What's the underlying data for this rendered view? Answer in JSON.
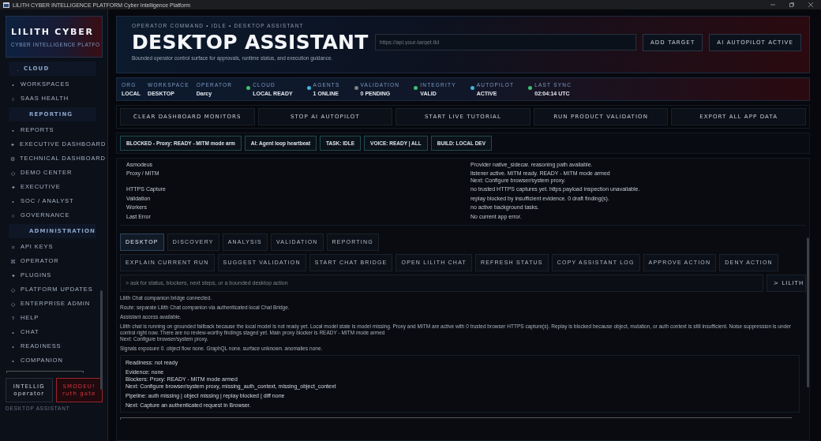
{
  "window": {
    "title": "LILITH CYBER INTELLIGENCE PLATFORM Cyber Intelligence Platform"
  },
  "brand": {
    "name": "LILITH CYBER",
    "tagline": "CYBER INTELLIGENCE PLATFO"
  },
  "sidebar": {
    "sections": [
      {
        "title": "CLOUD",
        "mark": ".",
        "items": [
          {
            "glyph": "•",
            "label": "WORKSPACES"
          },
          {
            "glyph": "○",
            "label": "SAAS HEALTH"
          }
        ]
      },
      {
        "title": "REPORTING",
        "items": [
          {
            "glyph": "▪",
            "label": "REPORTS"
          },
          {
            "glyph": "✦",
            "label": "EXECUTIVE DASHBOARD"
          },
          {
            "glyph": "⚙",
            "label": "TECHNICAL DASHBOARD"
          },
          {
            "glyph": "◇",
            "label": "DEMO CENTER"
          },
          {
            "glyph": "✦",
            "label": "EXECUTIVE"
          },
          {
            "glyph": "•",
            "label": "SOC / ANALYST"
          },
          {
            "glyph": "○",
            "label": "GOVERNANCE"
          }
        ]
      },
      {
        "title": "ADMINISTRATION",
        "items": [
          {
            "glyph": "≡",
            "label": "API KEYS"
          },
          {
            "glyph": "⌘",
            "label": "OPERATOR"
          },
          {
            "glyph": "✦",
            "label": "PLUGINS"
          },
          {
            "glyph": "◇",
            "label": "PLATFORM UPDATES"
          },
          {
            "glyph": "◇",
            "label": "ENTERPRISE ADMIN"
          },
          {
            "glyph": "?",
            "label": "HELP"
          },
          {
            "glyph": "•",
            "label": "CHAT"
          },
          {
            "glyph": "•",
            "label": "READINESS"
          },
          {
            "glyph": "•",
            "label": "COMPANION"
          }
        ]
      }
    ],
    "cards": [
      {
        "kind": "plain",
        "line1": "INTELLIG",
        "line2": "operator"
      },
      {
        "kind": "alert",
        "line1": "SMODEU!",
        "line2": "ruth gate"
      }
    ],
    "footer": "DESKTOP ASSISTANT"
  },
  "header": {
    "breadcrumb": "OPERATOR COMMAND • IDLE • DESKTOP ASSISTANT",
    "title": "DESKTOP ASSISTANT",
    "subtitle": "Bounded operator control surface for approvals, runtime status, and execution guidance.",
    "target": {
      "placeholder": "https://api.your-target.tld"
    },
    "buttons": [
      "ADD TARGET",
      "AI AUTOPILOT ACTIVE"
    ]
  },
  "context": [
    {
      "label": "ORG",
      "value": "LOCAL"
    },
    {
      "label": "WORKSPACE",
      "value": "DESKTOP"
    },
    {
      "label": "OPERATOR",
      "value": "Darcy"
    }
  ],
  "statuses": [
    {
      "label": "CLOUD",
      "value": "LOCAL READY",
      "color": "#3fbf6f"
    },
    {
      "label": "AGENTS",
      "value": "1 ONLINE",
      "color": "#3fb6d8"
    },
    {
      "label": "VALIDATION",
      "value": "0 PENDING",
      "color": "#7a808a"
    },
    {
      "label": "INTEGRITY",
      "value": "VALID",
      "color": "#3fbf6f"
    },
    {
      "label": "AUTOPILOT",
      "value": "ACTIVE",
      "color": "#3fb6d8"
    },
    {
      "label": "LAST SYNC",
      "value": "02:04:14 UTC",
      "color": "#3fbf6f"
    }
  ],
  "commands": [
    "CLEAR DASHBOARD MONITORS",
    "STOP AI AUTOPILOT",
    "START LIVE TUTORIAL",
    "RUN PRODUCT VALIDATION",
    "EXPORT ALL APP DATA"
  ],
  "chips": [
    "BLOCKED - Proxy: READY - MITM mode arm",
    "AI: Agent loop heartbeat",
    "TASK: IDLE",
    "VOICE: READY | ALL",
    "BUILD: LOCAL DEV"
  ],
  "info": [
    {
      "label": "Asmodeus",
      "value": "Provider native_sidecar. reasoning path available."
    },
    {
      "label": "Proxy / MITM",
      "value": "listener active. MITM ready. READY - MITM mode armed\nNext: Configure browser/system proxy."
    },
    {
      "label": "HTTPS Capture",
      "value": "no trusted HTTPS captures yet. https payload inspection unavailable."
    },
    {
      "label": "Validation",
      "value": "replay blocked by insufficient evidence. 0 draft finding(s)."
    },
    {
      "label": "Workers",
      "value": "no active background tasks."
    },
    {
      "label": "Last Error",
      "value": "No current app error."
    }
  ],
  "tabs": [
    {
      "label": "DESKTOP",
      "selected": true
    },
    {
      "label": "DISCOVERY",
      "selected": false
    },
    {
      "label": "ANALYSIS",
      "selected": false
    },
    {
      "label": "VALIDATION",
      "selected": false
    },
    {
      "label": "REPORTING",
      "selected": false
    }
  ],
  "actions": [
    "EXPLAIN CURRENT RUN",
    "SUGGEST VALIDATION",
    "START CHAT BRIDGE",
    "OPEN LILITH CHAT",
    "REFRESH STATUS",
    "COPY ASSISTANT LOG",
    "APPROVE ACTION",
    "DENY ACTION"
  ],
  "prompt": {
    "placeholder": "> ask for status, blockers, next steps, or a bounded desktop action",
    "send": "> LILITH"
  },
  "log": [
    "Lilith Chat companion bridge connected.",
    "Route: separate Lilith Chat companion via authenticated local Chat Bridge.",
    "Assistant access available.",
    "Lilith chat is running on grounded fallback because the local model is not ready yet. Local model state is model missing. Proxy and MITM are active with 0 trusted browser HTTPS capture(s). Replay is blocked because object, mutation, or auth context is still insufficient. Noise suppression is under control right now. There are no review-worthy findings staged yet. Main proxy blocker is READY - MITM mode armed\nNext: Configure browser/system proxy.",
    "Signals exposure 0. object flow none. GraphQL none. surface unknown. anomalies none."
  ],
  "summary": [
    "Readiness: not ready",
    "Evidence: none\nBlockers: Proxy: READY - MITM mode armed\nNext: Configure browser/system proxy, missing_auth_context, missing_object_context",
    "Pipeline: auth missing | object missing | replay blocked | diff none",
    "Next: Capture an authenticated request in Browser."
  ]
}
